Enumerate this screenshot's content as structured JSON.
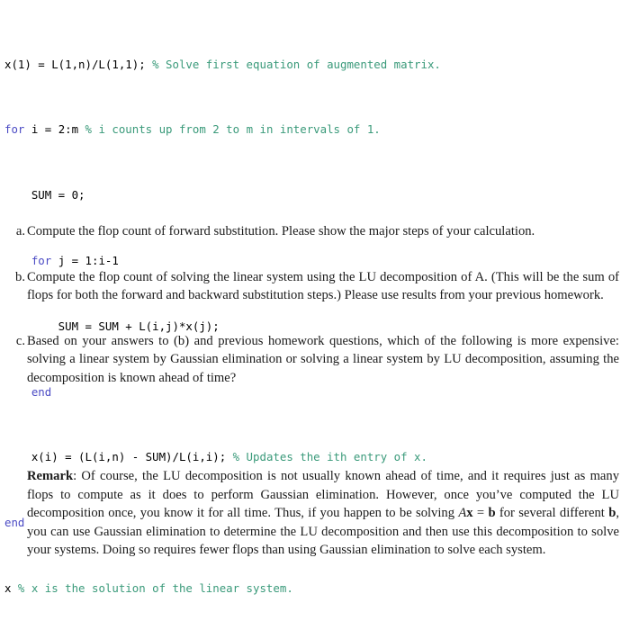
{
  "code_listing": {
    "language": "matlab",
    "colors": {
      "plain": "#000000",
      "keyword": "#4a4ac4",
      "comment": "#3a9a7a"
    },
    "lines": [
      {
        "code": "x(1) = L(1,n)/L(1,1); ",
        "comment": "% Solve first equation of augmented matrix."
      },
      {
        "keyword": "for",
        "code": " i = 2:m ",
        "comment": "% i counts up from 2 to m in intervals of 1."
      },
      {
        "code": "    SUM = 0;"
      },
      {
        "indent": "    ",
        "keyword": "for",
        "code": " j = 1:i-1"
      },
      {
        "code": "        SUM = SUM + L(i,j)*x(j);"
      },
      {
        "indent": "    ",
        "keyword": "end"
      },
      {
        "code": "    x(i) = (L(i,n) - SUM)/L(i,i); ",
        "comment": "% Updates the ith entry of x."
      },
      {
        "keyword": "end"
      },
      {
        "code": "x ",
        "comment": "% x is the solution of the linear system."
      }
    ]
  },
  "problems": [
    {
      "marker": "a.",
      "text": "Compute the flop count of forward substitution. Please show the major steps of your calculation."
    },
    {
      "marker": "b.",
      "text": "Compute the flop count of solving the linear system using the LU decomposition of A. (This will be the sum of flops for both the forward and backward substitution steps.) Please use results from your previous homework."
    },
    {
      "marker": "c.",
      "text": "Based on your answers to (b) and previous homework questions, which of the following is more expensive: solving a linear system by Gaussian elimination or solving a linear system by LU decomposition, assuming the decomposition is known ahead of time?"
    }
  ],
  "remark": {
    "label": "Remark",
    "part1": ": Of course, the LU decomposition is not usually known ahead of time, and it requires just as many flops to compute as it does to perform Gaussian elimination. However, once you’ve computed the LU decomposition once, you know it for all time. Thus, if you happen to be solving ",
    "math_A": "A",
    "math_x": "x",
    "math_eq": " = ",
    "math_b": "b",
    "part2": " for several different ",
    "math_b2": "b",
    "part3": ", you can use Gaussian elimination to determine the LU decomposition and then use this decomposition to solve your systems. Doing so requires fewer flops than using Gaussian elimination to solve each system."
  }
}
